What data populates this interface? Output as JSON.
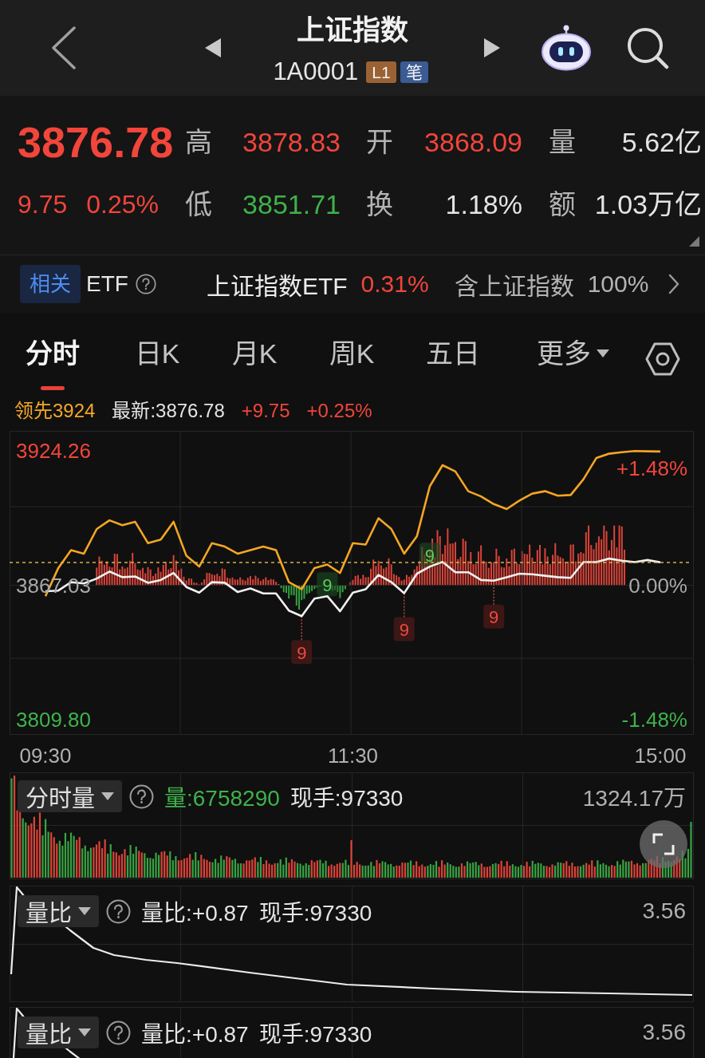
{
  "header": {
    "title": "上证指数",
    "code": "1A0001",
    "badges": [
      {
        "text": "L1",
        "color": "#9a6234"
      },
      {
        "text": "笔",
        "color": "#3a5b93"
      }
    ]
  },
  "quote": {
    "price": "3876.78",
    "change": "9.75",
    "change_pct": "0.25%",
    "color": "#f2453b",
    "stats": [
      {
        "label": "高",
        "value": "3878.83",
        "color": "#f2453b"
      },
      {
        "label": "开",
        "value": "3868.09",
        "color": "#f2453b"
      },
      {
        "label": "量",
        "value": "5.62亿",
        "color": "#e4e4e4"
      },
      {
        "label": "低",
        "value": "3851.71",
        "color": "#3fb24a"
      },
      {
        "label": "换",
        "value": "1.18%",
        "color": "#e4e4e4"
      },
      {
        "label": "额",
        "value": "1.03万亿",
        "color": "#e4e4e4"
      }
    ]
  },
  "related": {
    "tag": "相关",
    "label": "ETF",
    "fund": {
      "name": "上证指数ETF",
      "change": "0.31%",
      "color": "#f2453b"
    },
    "holding_label": "含上证指数",
    "holding": "100%"
  },
  "tabs": [
    {
      "label": "分时",
      "selected": true,
      "kind": "tab"
    },
    {
      "label": "日K",
      "selected": false,
      "kind": "tab"
    },
    {
      "label": "月K",
      "selected": false,
      "kind": "tab"
    },
    {
      "label": "周K",
      "selected": false,
      "kind": "tab"
    },
    {
      "label": "五日",
      "selected": false,
      "kind": "tab"
    },
    {
      "label": "更多",
      "selected": false,
      "kind": "dropdown"
    }
  ],
  "price_chart": {
    "legend": [
      {
        "text": "领先3924",
        "color": "#f4a62a"
      },
      {
        "text": "最新:3876.78",
        "color": "#e4e4e4"
      },
      {
        "text": "+9.75",
        "color": "#f2453b"
      },
      {
        "text": "+0.25%",
        "color": "#f2453b"
      }
    ],
    "pct_labels": [
      {
        "text": "+1.48%",
        "color": "#f2453b"
      },
      {
        "text": "0.00%",
        "color": "#a8a8a8"
      },
      {
        "text": "-1.48%",
        "color": "#3fb24a"
      }
    ],
    "chart_data": {
      "type": "line",
      "categories": [
        "09:30",
        null,
        null,
        null,
        null,
        null,
        null,
        null,
        null,
        null,
        null,
        null,
        null,
        null,
        null,
        null,
        null,
        null,
        null,
        null,
        null,
        null,
        null,
        null,
        "11:30",
        null,
        null,
        null,
        null,
        null,
        null,
        null,
        null,
        null,
        null,
        null,
        null,
        null,
        null,
        null,
        null,
        null,
        null,
        null,
        null,
        null,
        null,
        null,
        "15:00"
      ],
      "series": [
        {
          "color": "#f5a623",
          "values": [
            3862.4,
            3874.4,
            3882.0,
            3880.5,
            3891.0,
            3894.7,
            3892.6,
            3894.1,
            3885.0,
            3886.5,
            3894.1,
            3879.6,
            3875.0,
            3885.0,
            3883.5,
            3880.5,
            3882.0,
            3883.5,
            3882.0,
            3868.4,
            3865.4,
            3874.4,
            3875.9,
            3872.3,
            3885.0,
            3884.4,
            3895.6,
            3891.0,
            3880.5,
            3888.0,
            3909.2,
            3918.2,
            3915.5,
            3907.1,
            3904.9,
            3901.6,
            3899.5,
            3903.1,
            3906.1,
            3907.1,
            3905.2,
            3905.5,
            3912.2,
            3921.2,
            3923.1,
            3923.7,
            3924.2,
            3924.1,
            3924.0
          ]
        },
        {
          "color": "#f0f0f0",
          "values": [
            3864.5,
            3864.8,
            3868.4,
            3867.8,
            3869.9,
            3872.9,
            3870.5,
            3870.8,
            3868.1,
            3869.3,
            3872.3,
            3866.3,
            3863.9,
            3868.4,
            3868.1,
            3864.2,
            3865.7,
            3863.6,
            3863.6,
            3856.3,
            3853.9,
            3861.4,
            3862.4,
            3856.0,
            3863.9,
            3865.4,
            3871.4,
            3868.4,
            3863.7,
            3872.0,
            3875.0,
            3877.0,
            3872.6,
            3872.6,
            3869.3,
            3869.0,
            3870.5,
            3872.0,
            3871.7,
            3871.1,
            3870.5,
            3870.2,
            3876.9,
            3876.9,
            3878.4,
            3877.5,
            3876.9,
            3877.8,
            3876.8
          ]
        }
      ],
      "ylim": [
        3803.7,
        3932.8
      ],
      "yticks": [
        {
          "value": 3924.26,
          "label": "3924.26"
        },
        {
          "value": 3867.03,
          "label": "3867.03"
        },
        {
          "value": 3809.8,
          "label": "3809.80"
        }
      ],
      "ref_lines": [
        {
          "axis": "y",
          "value": 3876.78,
          "color": "#d6b04a"
        }
      ],
      "annotations": [
        {
          "text": "9",
          "y": 3875.0
        },
        {
          "text": "9",
          "y": 3862.4
        },
        {
          "text": "9",
          "y": 3869.0
        },
        {
          "text": "9",
          "y": 3863.7
        },
        {
          "text": "9",
          "y": 3853.9
        }
      ]
    }
  },
  "volume_panel": {
    "indicator": "分时量",
    "readings": [
      {
        "text": "量:6758290",
        "color": "#3fb24a"
      },
      {
        "text": "现手:97330",
        "color": "#e4e4e4"
      }
    ],
    "max_label": "1324.17万"
  },
  "ratio_panels": [
    {
      "indicator": "量比",
      "readings": [
        {
          "text": "量比:+0.87",
          "color": "#e4e4e4"
        },
        {
          "text": "现手:97330",
          "color": "#e4e4e4"
        }
      ],
      "max_label": "3.56"
    },
    {
      "indicator": "量比",
      "readings": [
        {
          "text": "量比:+0.87",
          "color": "#e4e4e4"
        },
        {
          "text": "现手:97330",
          "color": "#e4e4e4"
        }
      ],
      "max_label": "3.56"
    }
  ]
}
